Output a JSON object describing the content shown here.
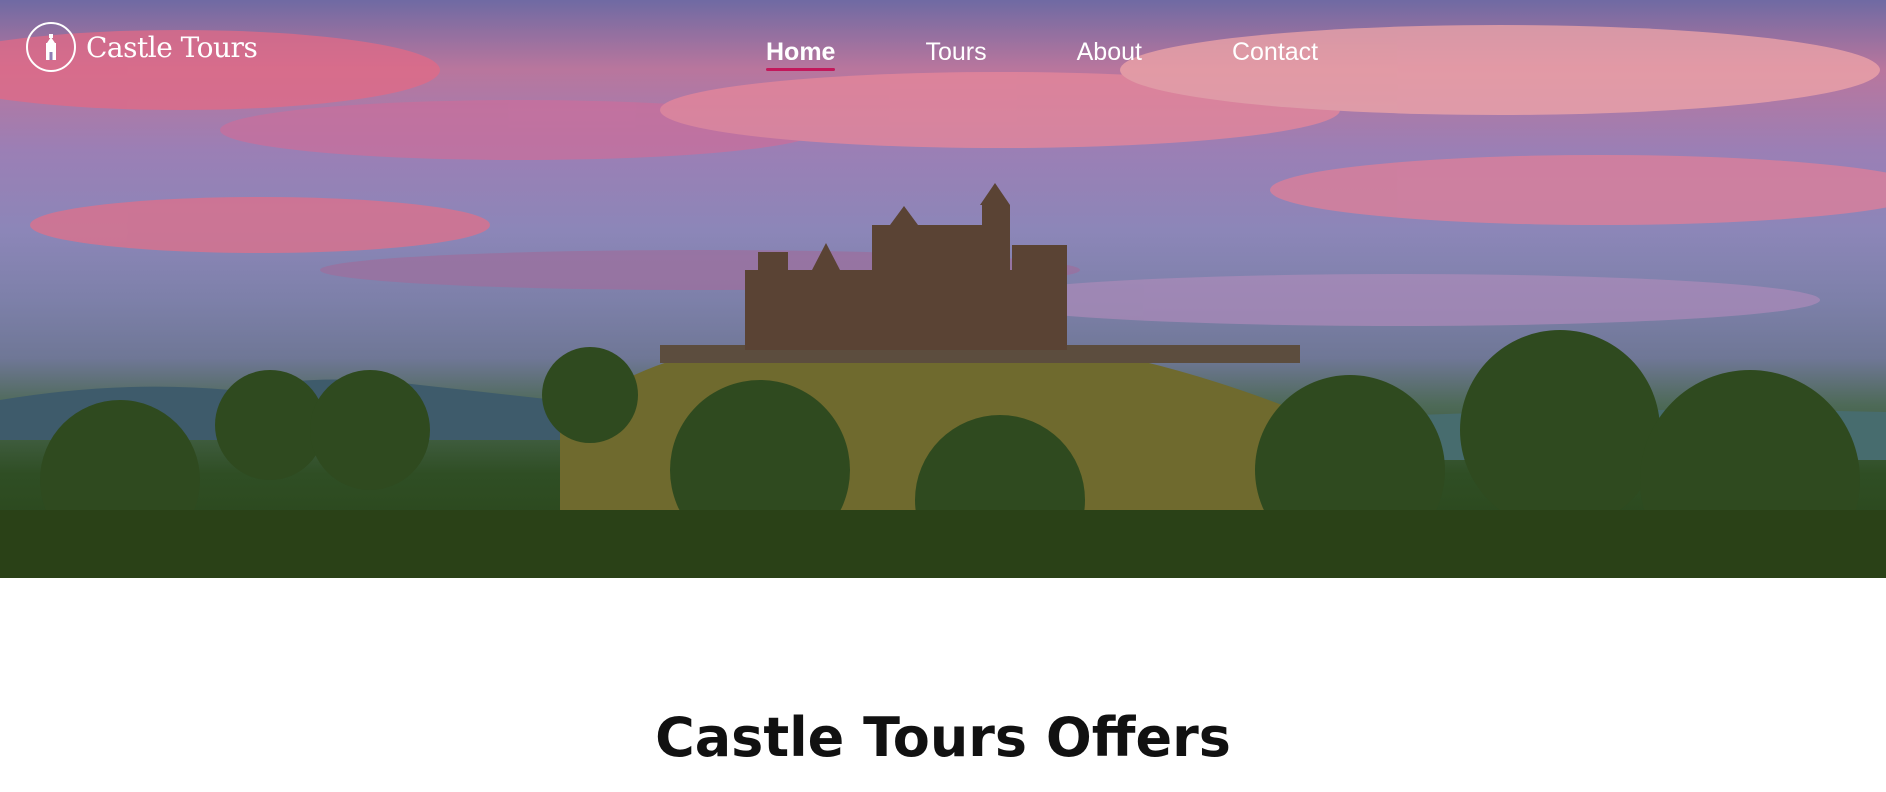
{
  "brand": {
    "name": "Castle Tours",
    "logo_icon": "tower-icon"
  },
  "nav": {
    "items": [
      {
        "label": "Home",
        "active": true
      },
      {
        "label": "Tours",
        "active": false
      },
      {
        "label": "About",
        "active": false
      },
      {
        "label": "Contact",
        "active": false
      }
    ]
  },
  "hero": {
    "image": "castle-on-hill-at-sunset"
  },
  "offers": {
    "title": "Castle Tours Offers"
  },
  "colors": {
    "accent": "#c2185b",
    "nav_text": "#ffffff",
    "title_text": "#111111"
  }
}
